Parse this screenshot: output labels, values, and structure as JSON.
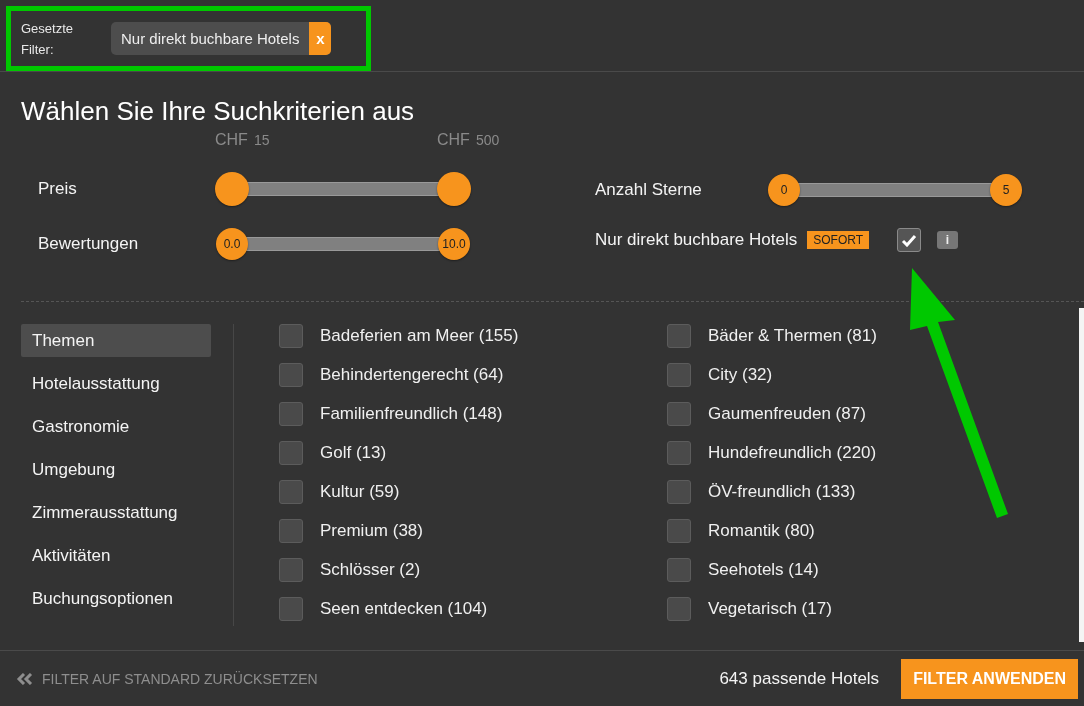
{
  "active_filters": {
    "label": "Gesetzte Filter:",
    "chips": [
      {
        "label": "Nur direkt buchbare Hotels",
        "remove": "x"
      }
    ]
  },
  "title": "Wählen Sie Ihre Suchkriterien aus",
  "left_criteria": [
    {
      "kind": "range",
      "label": "Preis",
      "handles": [
        {
          "level": 0,
          "currency": "CHF",
          "value": "15"
        },
        {
          "level": 1,
          "currency": "CHF",
          "value": "500"
        }
      ]
    },
    {
      "kind": "range",
      "label": "Bewertungen",
      "handles": [
        {
          "level": 0,
          "thumb": "0.0"
        },
        {
          "level": 1,
          "thumb": "10.0"
        }
      ]
    }
  ],
  "right_criteria": [
    {
      "kind": "range",
      "label": "Anzahl Sterne",
      "handles": [
        {
          "level": 0,
          "thumb": "0"
        },
        {
          "level": 1,
          "thumb": "5"
        }
      ]
    },
    {
      "kind": "toggle",
      "label": "Nur direkt buchbare Hotels",
      "badge": "SOFORT",
      "checked": true,
      "info": "i"
    }
  ],
  "categories": [
    {
      "label": "Themen",
      "selected": true
    },
    {
      "label": "Hotelausstattung",
      "selected": false
    },
    {
      "label": "Gastronomie",
      "selected": false
    },
    {
      "label": "Umgebung",
      "selected": false
    },
    {
      "label": "Zimmerausstattung",
      "selected": false
    },
    {
      "label": "Aktivitäten",
      "selected": false
    },
    {
      "label": "Buchungsoptionen",
      "selected": false
    }
  ],
  "options": [
    {
      "label": "Badeferien am Meer (155)",
      "checked": false
    },
    {
      "label": "Bäder & Thermen (81)",
      "checked": false
    },
    {
      "label": "Behindertengerecht (64)",
      "checked": false
    },
    {
      "label": "City (32)",
      "checked": false
    },
    {
      "label": "Familienfreundlich (148)",
      "checked": false
    },
    {
      "label": "Gaumenfreuden (87)",
      "checked": false
    },
    {
      "label": "Golf (13)",
      "checked": false
    },
    {
      "label": "Hundefreundlich (220)",
      "checked": false
    },
    {
      "label": "Kultur (59)",
      "checked": false
    },
    {
      "label": "ÖV-freundlich (133)",
      "checked": false
    },
    {
      "label": "Premium (38)",
      "checked": false
    },
    {
      "label": "Romantik (80)",
      "checked": false
    },
    {
      "label": "Schlösser (2)",
      "checked": false
    },
    {
      "label": "Seehotels (14)",
      "checked": false
    },
    {
      "label": "Seen entdecken (104)",
      "checked": false
    },
    {
      "label": "Vegetarisch (17)",
      "checked": false
    }
  ],
  "footer": {
    "reset": "FILTER AUF STANDARD ZURÜCKSETZEN",
    "count": "643 passende Hotels",
    "apply": "FILTER ANWENDEN"
  }
}
